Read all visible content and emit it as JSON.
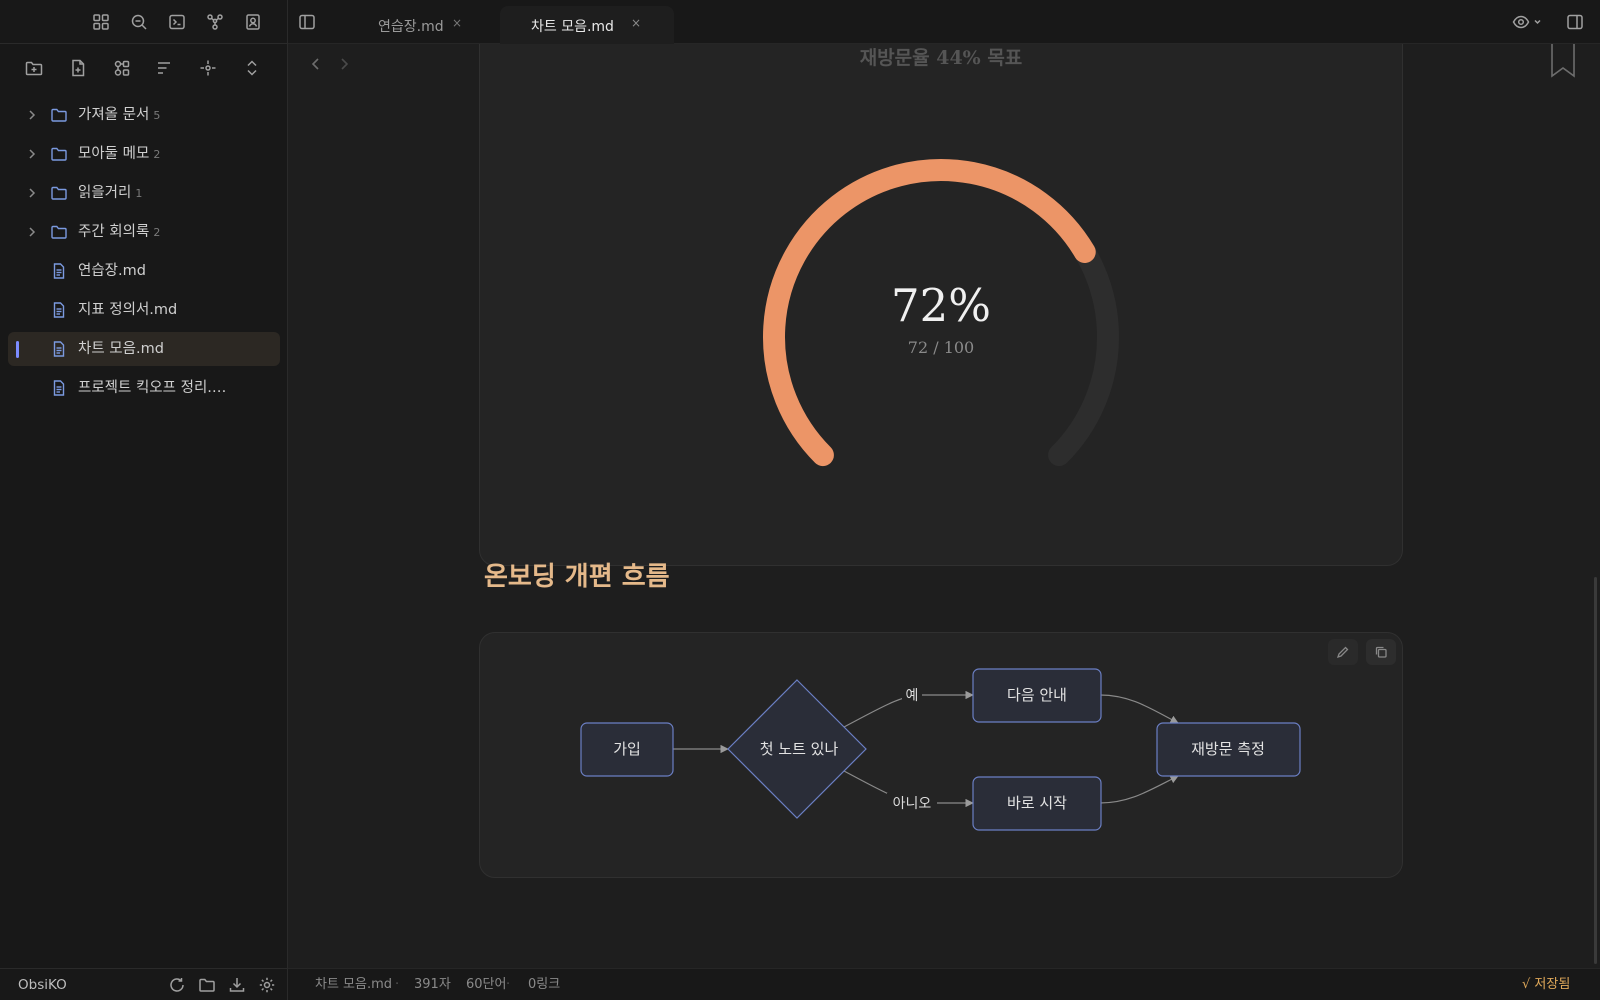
{
  "app": {
    "vault_name": "ObsiKO"
  },
  "sidebar": {
    "tree": [
      {
        "type": "folder",
        "label": "가져올 문서",
        "count": "5"
      },
      {
        "type": "folder",
        "label": "모아둘 메모",
        "count": "2"
      },
      {
        "type": "folder",
        "label": "읽을거리",
        "count": "1"
      },
      {
        "type": "folder",
        "label": "주간 회의록",
        "count": "2"
      },
      {
        "type": "file",
        "label": "연습장.md"
      },
      {
        "type": "file",
        "label": "지표 정의서.md"
      },
      {
        "type": "file",
        "label": "차트 모음.md",
        "active": true
      },
      {
        "type": "file",
        "label": "프로젝트 킥오프 정리.…"
      }
    ]
  },
  "tabs": [
    {
      "label": "연습장.md",
      "close": "×",
      "active": false
    },
    {
      "label": "차트 모음.md",
      "close": "×",
      "active": true
    }
  ],
  "content": {
    "gauge": {
      "title": "재방문율 44% 목표",
      "value": 72,
      "max": 100,
      "value_label": "72%",
      "sub_label": "72 / 100",
      "colors": {
        "fill": "#ec9567",
        "track": "#2d2d2d"
      }
    },
    "heading": "온보딩 개편 흐름",
    "flow": {
      "nodes": {
        "signup": "가입",
        "decision": "첫 노트 있나",
        "next_guide": "다음 안내",
        "start_now": "바로 시작",
        "measure": "재방문 측정"
      },
      "edge_labels": {
        "yes": "예",
        "no": "아니오"
      },
      "colors": {
        "node_fill": "#2a2d38",
        "node_stroke": "#6b7fc4",
        "edge": "#8a8a8a"
      }
    }
  },
  "statusbar": {
    "file": "차트 모음.md",
    "chars": "391자",
    "words": "60단어",
    "links": "0링크",
    "saved": "√ 저장됨"
  }
}
